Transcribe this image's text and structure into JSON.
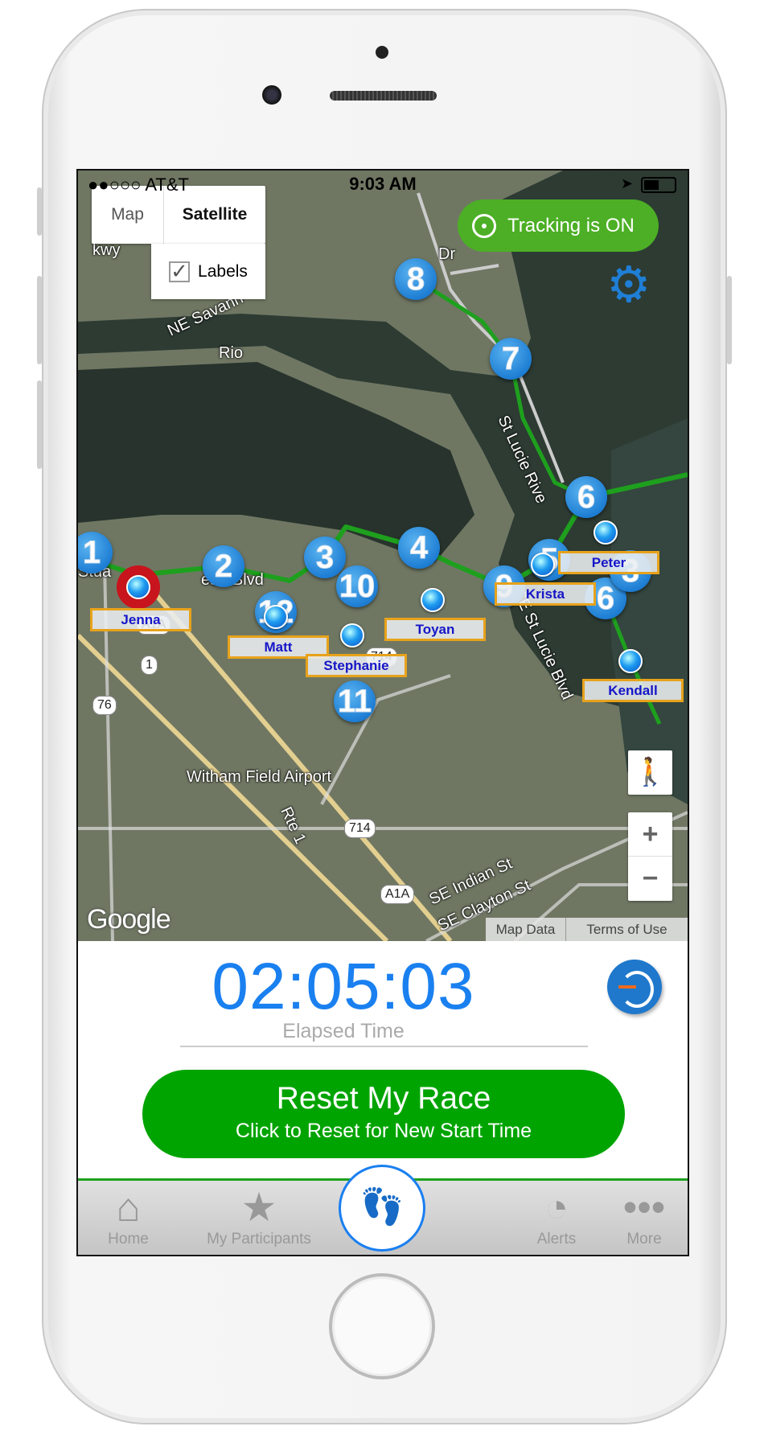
{
  "status_bar": {
    "carrier": "●●○○○ AT&T",
    "wifi_icon": "wifi-icon",
    "time": "9:03 AM"
  },
  "map": {
    "type_map": "Map",
    "type_satellite": "Satellite",
    "selected_type": "Satellite",
    "labels_label": "Labels",
    "labels_checked": true,
    "tracking_label": "Tracking is ON",
    "tracking_color": "#4caf25",
    "course_markers": [
      "8",
      "7",
      "6",
      "1",
      "2",
      "3",
      "4",
      "10",
      "11",
      "9",
      "5",
      "6",
      "3",
      "12"
    ],
    "participants": [
      {
        "name": "Jenna",
        "highlight": true
      },
      {
        "name": "Matt"
      },
      {
        "name": "Stephanie"
      },
      {
        "name": "Toyan"
      },
      {
        "name": "Krista"
      },
      {
        "name": "Peter"
      },
      {
        "name": "Kendall"
      }
    ],
    "place_labels": {
      "rio": "Rio",
      "savanna": "NE Savann",
      "stuart": "Stua",
      "blvd": "ean Blvd",
      "river": "St Lucie Rive",
      "lucie_blvd": "SE St Lucie Blvd",
      "airport": "Witham Field Airport",
      "rte1": "Rte 1",
      "indian": "SE Indian St",
      "clayton": "SE Clayton St",
      "dr": "Dr",
      "pkwy": "kwy"
    },
    "shields": [
      "A1A",
      "1",
      "76",
      "714",
      "714",
      "A1A"
    ],
    "zoom_in": "+",
    "zoom_out": "−",
    "google_logo": "Google",
    "map_data": "Map Data",
    "terms": "Terms of Use"
  },
  "timer": {
    "hours": "02",
    "minutes": "05",
    "seconds": "03",
    "sep": ":",
    "caption": "Elapsed Time"
  },
  "reset_button": {
    "title": "Reset My Race",
    "subtitle": "Click to Reset for New Start Time",
    "color": "#00a400"
  },
  "tabs": [
    {
      "label": "Home",
      "icon": "home-icon"
    },
    {
      "label": "My Participants",
      "icon": "star-plus-icon"
    },
    {
      "label": "",
      "icon": "footprints-icon"
    },
    {
      "label": "Alerts",
      "icon": "timer-alert-icon"
    },
    {
      "label": "More",
      "icon": "more-dots-icon"
    }
  ]
}
